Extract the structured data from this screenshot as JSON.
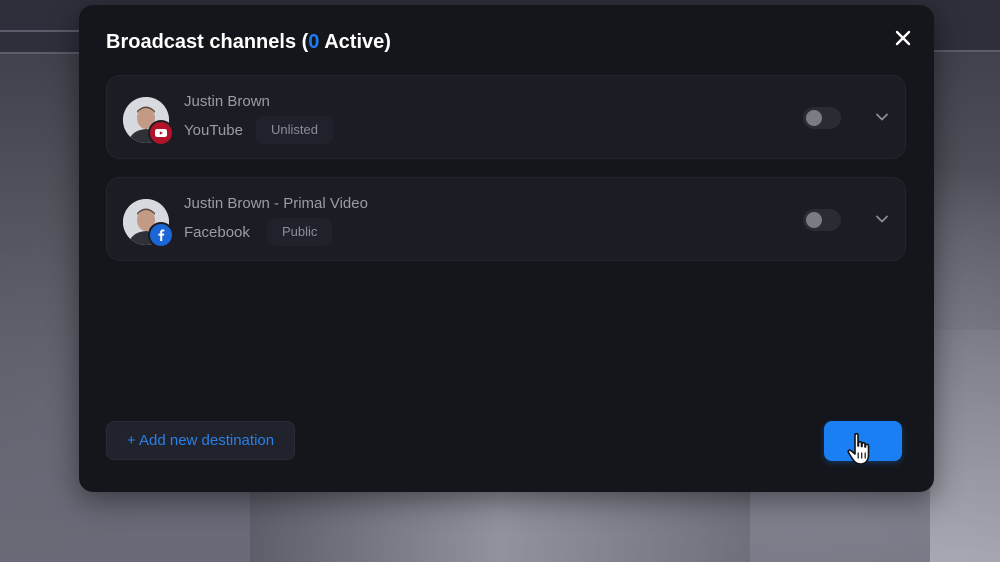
{
  "modal": {
    "title_prefix": "Broadcast channels (",
    "active_count": "0",
    "title_suffix": " Active)",
    "close_icon": "close-icon"
  },
  "channels": [
    {
      "name": "Justin Brown",
      "platform": "YouTube",
      "privacy": "Unlisted",
      "platform_icon": "youtube-icon",
      "platform_color": "#b1132a",
      "enabled": false
    },
    {
      "name": "Justin Brown - Primal Video",
      "platform": "Facebook",
      "privacy": "Public",
      "platform_icon": "facebook-icon",
      "platform_color": "#1b66d6",
      "enabled": false
    }
  ],
  "footer": {
    "add_destination_label": "+ Add new destination"
  },
  "colors": {
    "accent": "#1e7bf0",
    "modal_bg": "#15161c",
    "card_bg": "#1c1d24"
  }
}
